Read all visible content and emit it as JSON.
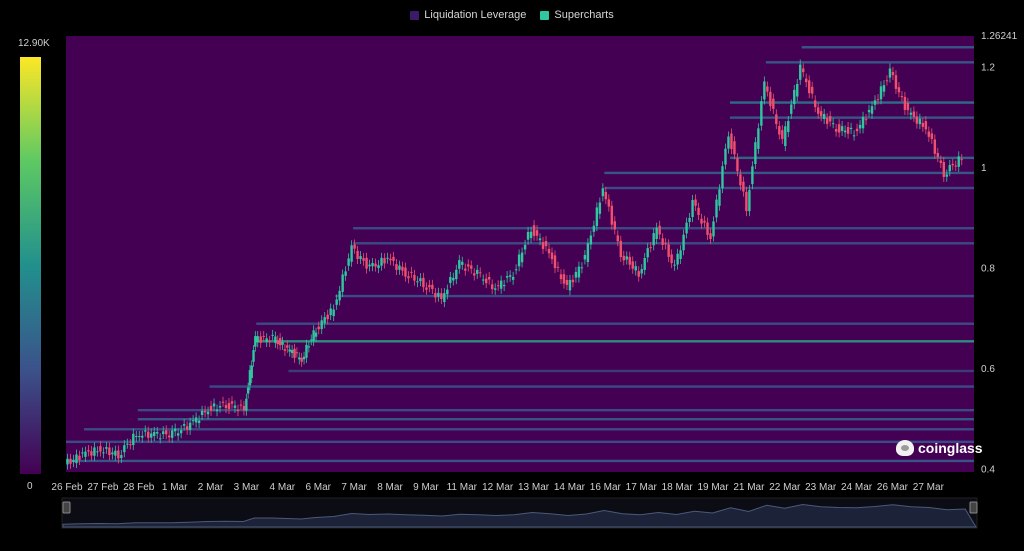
{
  "legend": [
    {
      "label": "Liquidation Leverage",
      "color": "#3c1a6a"
    },
    {
      "label": "Supercharts",
      "color": "#2ec7a0"
    }
  ],
  "colorscale": {
    "max_label": "12.90K",
    "min_label": "0",
    "max": 12900,
    "min": 0,
    "colors": [
      "#440154",
      "#3b528b",
      "#21908d",
      "#5dc963",
      "#fde725"
    ]
  },
  "watermark": "coinglass",
  "chart_data": {
    "type": "heatmap",
    "background_color": "#440154",
    "x_tick_labels": [
      "26 Feb",
      "27 Feb",
      "28 Feb",
      "1 Mar",
      "2 Mar",
      "3 Mar",
      "4 Mar",
      "6 Mar",
      "7 Mar",
      "8 Mar",
      "9 Mar",
      "11 Mar",
      "12 Mar",
      "13 Mar",
      "14 Mar",
      "16 Mar",
      "17 Mar",
      "18 Mar",
      "19 Mar",
      "21 Mar",
      "22 Mar",
      "23 Mar",
      "24 Mar",
      "26 Mar",
      "27 Mar"
    ],
    "x_tick_days": [
      0,
      1,
      2,
      3,
      4,
      5,
      6,
      7,
      8,
      9,
      10,
      11,
      12,
      13,
      14,
      15,
      16,
      17,
      18,
      19,
      20,
      21,
      22,
      23,
      24
    ],
    "x_range_days": [
      0,
      25.3
    ],
    "y_tick_labels": [
      "0.4",
      "0.6",
      "0.8",
      "1",
      "1.2",
      "1.26241"
    ],
    "y_ticks": [
      0.4,
      0.6,
      0.8,
      1.0,
      1.2,
      1.26241
    ],
    "ylim": [
      0.395,
      1.26241
    ],
    "price_series_approx": [
      {
        "day": 0,
        "price": 0.41
      },
      {
        "day": 0.5,
        "price": 0.43
      },
      {
        "day": 1,
        "price": 0.44
      },
      {
        "day": 1.5,
        "price": 0.43
      },
      {
        "day": 2,
        "price": 0.47
      },
      {
        "day": 2.5,
        "price": 0.47
      },
      {
        "day": 3,
        "price": 0.47
      },
      {
        "day": 3.5,
        "price": 0.49
      },
      {
        "day": 4,
        "price": 0.52
      },
      {
        "day": 4.5,
        "price": 0.53
      },
      {
        "day": 5,
        "price": 0.52
      },
      {
        "day": 5.3,
        "price": 0.66
      },
      {
        "day": 5.8,
        "price": 0.66
      },
      {
        "day": 6.2,
        "price": 0.64
      },
      {
        "day": 6.6,
        "price": 0.62
      },
      {
        "day": 7,
        "price": 0.68
      },
      {
        "day": 7.5,
        "price": 0.72
      },
      {
        "day": 8,
        "price": 0.84
      },
      {
        "day": 8.5,
        "price": 0.8
      },
      {
        "day": 9,
        "price": 0.82
      },
      {
        "day": 9.5,
        "price": 0.79
      },
      {
        "day": 10,
        "price": 0.77
      },
      {
        "day": 10.5,
        "price": 0.74
      },
      {
        "day": 11,
        "price": 0.81
      },
      {
        "day": 11.5,
        "price": 0.79
      },
      {
        "day": 12,
        "price": 0.76
      },
      {
        "day": 12.5,
        "price": 0.79
      },
      {
        "day": 13,
        "price": 0.88
      },
      {
        "day": 13.5,
        "price": 0.83
      },
      {
        "day": 14,
        "price": 0.76
      },
      {
        "day": 14.5,
        "price": 0.82
      },
      {
        "day": 15,
        "price": 0.96
      },
      {
        "day": 15.5,
        "price": 0.83
      },
      {
        "day": 16,
        "price": 0.79
      },
      {
        "day": 16.5,
        "price": 0.88
      },
      {
        "day": 17,
        "price": 0.8
      },
      {
        "day": 17.5,
        "price": 0.93
      },
      {
        "day": 18,
        "price": 0.86
      },
      {
        "day": 18.5,
        "price": 1.07
      },
      {
        "day": 19,
        "price": 0.92
      },
      {
        "day": 19.5,
        "price": 1.17
      },
      {
        "day": 20,
        "price": 1.05
      },
      {
        "day": 20.5,
        "price": 1.2
      },
      {
        "day": 21,
        "price": 1.11
      },
      {
        "day": 21.5,
        "price": 1.08
      },
      {
        "day": 22,
        "price": 1.07
      },
      {
        "day": 22.5,
        "price": 1.12
      },
      {
        "day": 23,
        "price": 1.19
      },
      {
        "day": 23.5,
        "price": 1.11
      },
      {
        "day": 24,
        "price": 1.08
      },
      {
        "day": 24.5,
        "price": 0.99
      },
      {
        "day": 25,
        "price": 1.02
      }
    ],
    "liquidation_bands": [
      {
        "price": 0.417,
        "intensity": 0.3
      },
      {
        "price": 0.455,
        "intensity": 0.25
      },
      {
        "price": 0.48,
        "intensity": 0.25
      },
      {
        "price": 0.5,
        "intensity": 0.3
      },
      {
        "price": 0.518,
        "intensity": 0.25
      },
      {
        "price": 0.565,
        "intensity": 0.25
      },
      {
        "price": 0.596,
        "intensity": 0.2
      },
      {
        "price": 0.655,
        "intensity": 0.55
      },
      {
        "price": 0.69,
        "intensity": 0.25
      },
      {
        "price": 0.745,
        "intensity": 0.25
      },
      {
        "price": 0.85,
        "intensity": 0.25
      },
      {
        "price": 0.88,
        "intensity": 0.25
      },
      {
        "price": 0.96,
        "intensity": 0.25
      },
      {
        "price": 0.99,
        "intensity": 0.3
      },
      {
        "price": 1.02,
        "intensity": 0.35
      },
      {
        "price": 1.1,
        "intensity": 0.3
      },
      {
        "price": 1.13,
        "intensity": 0.4
      },
      {
        "price": 1.21,
        "intensity": 0.3
      },
      {
        "price": 1.24,
        "intensity": 0.3
      }
    ]
  }
}
